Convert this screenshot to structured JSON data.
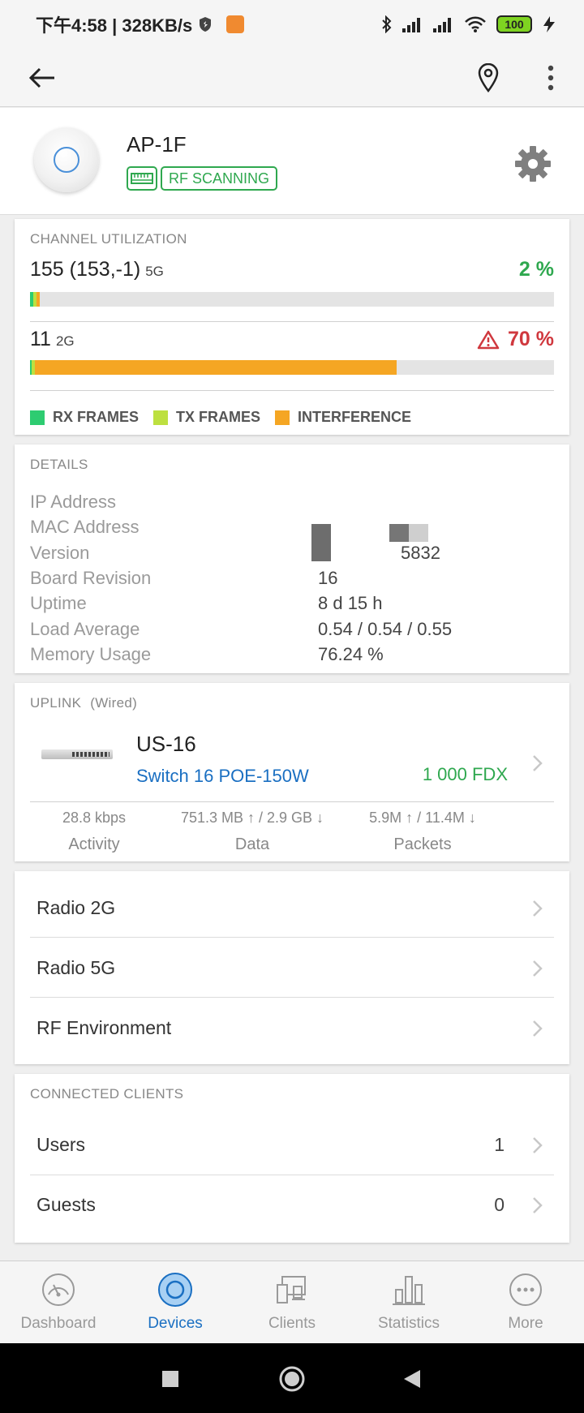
{
  "status_bar": {
    "time_speed": "下午4:58 | 328KB/s",
    "battery": "100"
  },
  "device": {
    "name": "AP-1F",
    "tag": "RF SCANNING"
  },
  "channel_utilization": {
    "title": "CHANNEL UTILIZATION",
    "channels": [
      {
        "number": "155 (153,-1)",
        "band": "5G",
        "percent_text": "2 %",
        "percent_color": "#2fa84f",
        "rx_fraction": 0.006,
        "tx_fraction": 0.006,
        "interference_fraction": 0.006
      },
      {
        "number": "11",
        "band": "2G",
        "percent_text": "70 %",
        "percent_color": "#d0383e",
        "rx_fraction": 0.003,
        "tx_fraction": 0.007,
        "interference_fraction": 0.69
      }
    ],
    "legend": {
      "rx": "RX FRAMES",
      "tx": "TX FRAMES",
      "interference": "INTERFERENCE"
    },
    "colors": {
      "rx": "#2ecc71",
      "tx": "#bde040",
      "interference": "#f5a623"
    }
  },
  "details": {
    "title": "DETAILS",
    "rows": [
      {
        "label": "IP Address",
        "value": ""
      },
      {
        "label": "MAC Address",
        "value": ""
      },
      {
        "label": "Version",
        "value": "5832"
      },
      {
        "label": "Board Revision",
        "value": "16"
      },
      {
        "label": "Uptime",
        "value": "8 d 15 h"
      },
      {
        "label": "Load Average",
        "value": "0.54 / 0.54 / 0.55"
      },
      {
        "label": "Memory Usage",
        "value": "76.24 %"
      }
    ]
  },
  "uplink": {
    "title": "UPLINK",
    "type": "(Wired)",
    "device_name": "US-16",
    "model": "Switch 16 POE-150W",
    "speed": "1 000 FDX",
    "stats": [
      {
        "value": "28.8 kbps",
        "label": "Activity"
      },
      {
        "value": "751.3 MB ↑ / 2.9 GB ↓",
        "label": "Data"
      },
      {
        "value": "5.9M ↑ / 11.4M ↓",
        "label": "Packets"
      }
    ]
  },
  "radio_links": [
    {
      "label": "Radio 2G"
    },
    {
      "label": "Radio 5G"
    },
    {
      "label": "RF Environment"
    }
  ],
  "connected_clients": {
    "title": "CONNECTED CLIENTS",
    "items": [
      {
        "label": "Users",
        "count": "1"
      },
      {
        "label": "Guests",
        "count": "0"
      }
    ]
  },
  "bottom_nav": {
    "active_color": "#1a6fc2",
    "items": [
      {
        "label": "Dashboard",
        "icon": "dashboard-icon"
      },
      {
        "label": "Devices",
        "icon": "devices-icon"
      },
      {
        "label": "Clients",
        "icon": "clients-icon"
      },
      {
        "label": "Statistics",
        "icon": "statistics-icon"
      },
      {
        "label": "More",
        "icon": "more-icon"
      }
    ]
  }
}
